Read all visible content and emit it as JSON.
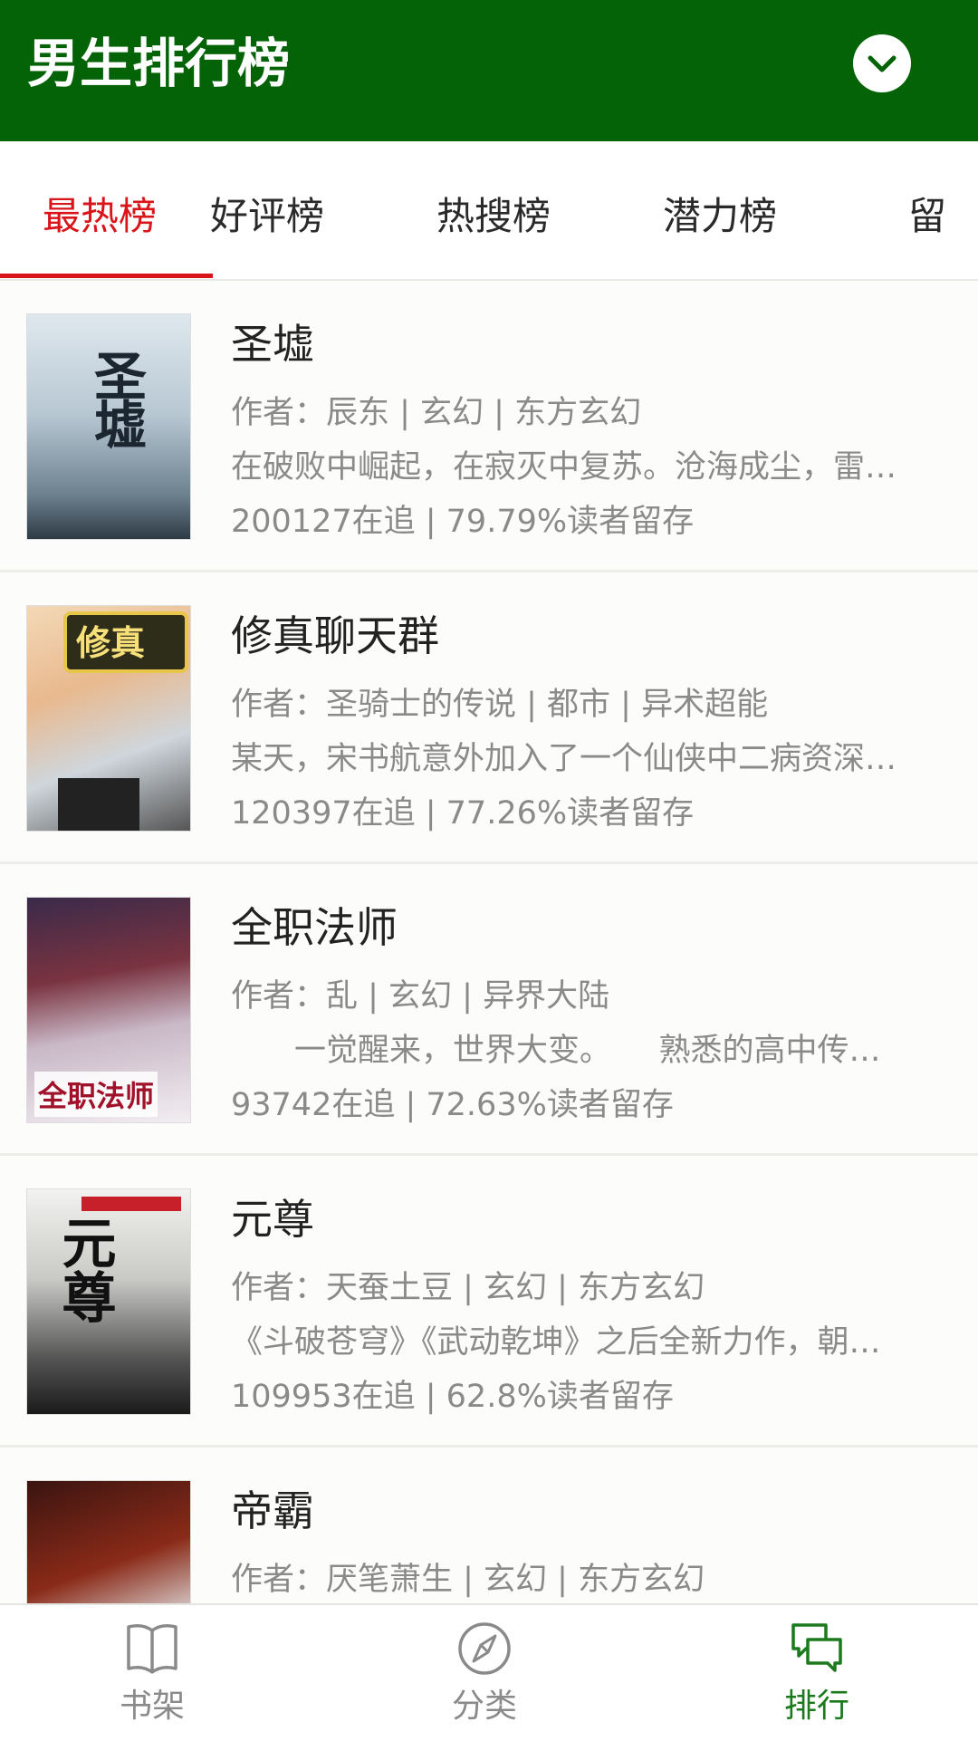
{
  "header": {
    "title": "男生排行榜"
  },
  "tabs": [
    {
      "label": "最热榜",
      "active": true
    },
    {
      "label": "好评榜",
      "active": false
    },
    {
      "label": "热搜榜",
      "active": false
    },
    {
      "label": "潜力榜",
      "active": false
    },
    {
      "label": "留",
      "active": false
    }
  ],
  "books": [
    {
      "title": "圣墟",
      "meta": "作者：辰东 | 玄幻 | 东方玄幻",
      "desc": "在破败中崛起，在寂灭中复苏。沧海成尘，雷…",
      "stats": "200127在追 | 79.79%读者留存",
      "cover_text": "圣墟"
    },
    {
      "title": "修真聊天群",
      "meta": "作者：圣骑士的传说 | 都市 | 异术超能",
      "desc": "某天，宋书航意外加入了一个仙侠中二病资深…",
      "stats": "120397在追 | 77.26%读者留存",
      "cover_text": "修真"
    },
    {
      "title": "全职法师",
      "meta": "作者：乱 | 玄幻 | 异界大陆",
      "desc": "　　一觉醒来，世界大变。　　熟悉的高中传…",
      "stats": "93742在追 | 72.63%读者留存",
      "cover_text": "全职法师"
    },
    {
      "title": "元尊",
      "meta": "作者：天蚕土豆 | 玄幻 | 东方玄幻",
      "desc": "《斗破苍穹》《武动乾坤》之后全新力作，朝…",
      "stats": "109953在追 | 62.8%读者留存",
      "cover_text": "元尊"
    },
    {
      "title": "帝霸",
      "meta": "作者：厌笔萧生 | 玄幻 | 东方玄幻",
      "desc": "",
      "stats": "",
      "cover_text": ""
    }
  ],
  "bottom_nav": [
    {
      "label": "书架",
      "icon": "book-icon",
      "active": false
    },
    {
      "label": "分类",
      "icon": "compass-icon",
      "active": false
    },
    {
      "label": "排行",
      "icon": "chat-bubbles-icon",
      "active": true
    }
  ],
  "colors": {
    "header_bg": "#056307",
    "active_tab": "#d9151b",
    "active_nav": "#1a7a1c"
  }
}
